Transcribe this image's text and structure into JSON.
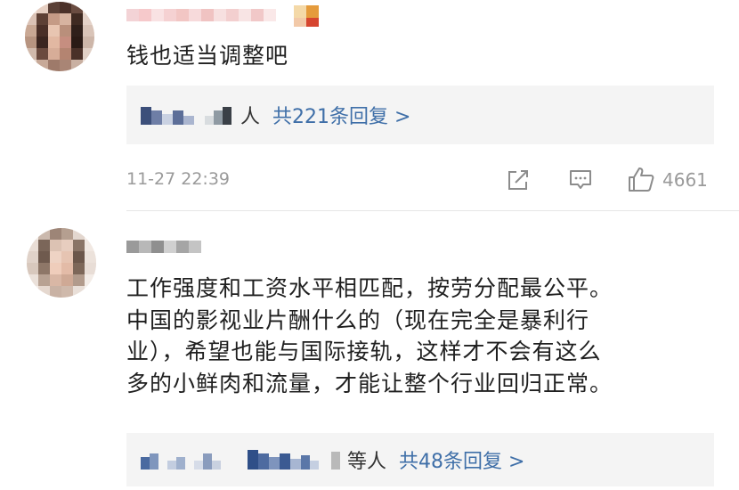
{
  "comments": [
    {
      "text_lines": [
        "钱也适当调整吧"
      ],
      "replies": {
        "suffix": "人",
        "count_text": "共221条回复 >"
      },
      "timestamp": "11-27 22:39",
      "likes": "4661"
    },
    {
      "text_lines": [
        "工作强度和工资水平相匹配，按劳分配最公平。",
        "中国的影视业片酬什么的（现在完全是暴利行",
        "业），希望也能与国际接轨，这样才不会有这么",
        "多的小鲜肉和流量，才能让整个行业回归正常。"
      ],
      "replies": {
        "suffix": "等人",
        "count_text": "共48条回复 >"
      }
    }
  ],
  "icons": {
    "share": "share-icon",
    "comment": "comment-icon",
    "like": "thumbs-up-icon"
  },
  "colors": {
    "link": "#3f6fa8",
    "meta": "#9a9a9a",
    "reply_bg": "#f4f4f4"
  }
}
